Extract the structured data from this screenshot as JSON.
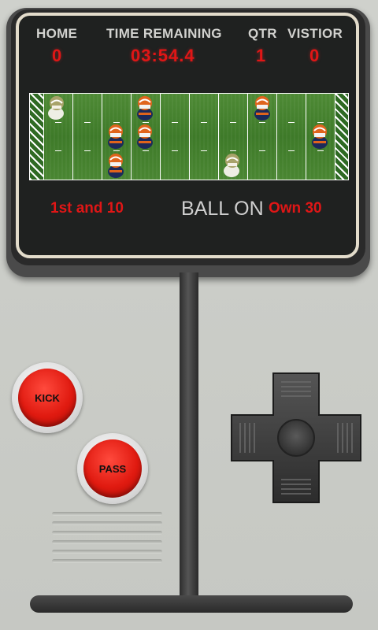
{
  "scoreboard": {
    "home_label": "HOME",
    "time_label": "TIME REMAINING",
    "qtr_label": "QTR",
    "visitor_label": "VISTIOR",
    "home_score": "0",
    "time_remaining": "03:54.4",
    "quarter": "1",
    "visitor_score": "0"
  },
  "situation": {
    "down_distance": "1st and 10",
    "ball_on_label": "BALL ON",
    "ball_spot": "Own 30"
  },
  "controls": {
    "kick_label": "KICK",
    "pass_label": "PASS"
  },
  "colors": {
    "display_red": "#e01616",
    "home_team": "#f0efe6",
    "visitor_team": "#e0641c"
  }
}
